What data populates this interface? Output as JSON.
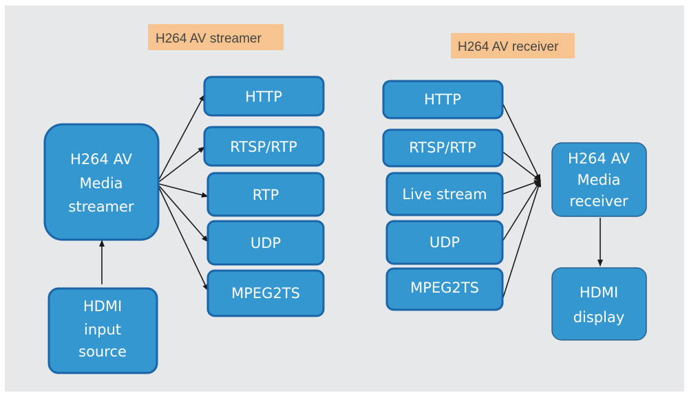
{
  "colors": {
    "background": "#e7e8ea",
    "box_fill": "#3597cf",
    "box_border": "#1a64a8",
    "label_fill": "#f7c48f"
  },
  "streamer": {
    "title": "H264 AV streamer",
    "main": [
      "H264 AV",
      "Media",
      "streamer"
    ],
    "source": [
      "HDMI",
      "input",
      "source"
    ],
    "protocols": [
      "HTTP",
      "RTSP/RTP",
      "RTP",
      "UDP",
      "MPEG2TS"
    ]
  },
  "receiver": {
    "title": "H264 AV receiver",
    "protocols": [
      "HTTP",
      "RTSP/RTP",
      "Live stream",
      "UDP",
      "MPEG2TS"
    ],
    "main": [
      "H264 AV",
      "Media",
      "receiver"
    ],
    "output": [
      "HDMI",
      "display"
    ]
  }
}
